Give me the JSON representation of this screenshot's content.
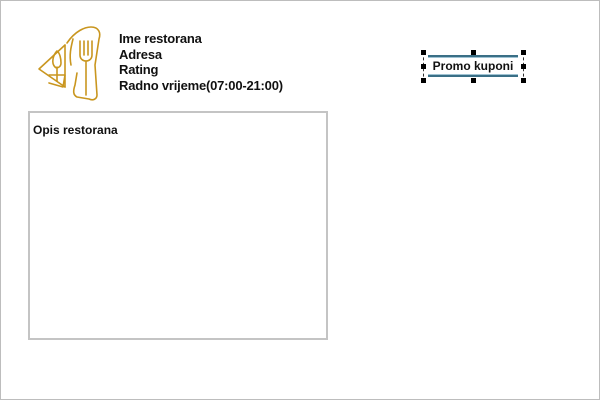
{
  "restaurant": {
    "name": "Ime restorana",
    "address": "Adresa",
    "rating": "Rating",
    "hours": "Radno vrijeme(07:00-21:00)"
  },
  "description": {
    "label": "Opis restorana"
  },
  "promo": {
    "label": "Promo kuponi"
  },
  "logo": {
    "icon": "restaurant-cutlery-logo",
    "color": "#c9961f"
  },
  "colors": {
    "button_border": "#3a6f86",
    "box_border": "#c4c4c4"
  }
}
